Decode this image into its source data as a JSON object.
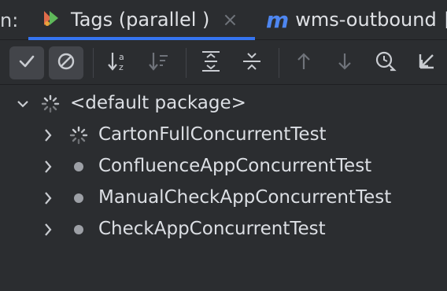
{
  "tabbar": {
    "prefix": "n:",
    "tabs": [
      {
        "label": "Tags (parallel )",
        "icon": "run-test-icon",
        "active": true,
        "close": "×"
      },
      {
        "label": "wms-outbound",
        "icon": "maven-module-icon",
        "active": false,
        "trail": "["
      }
    ]
  },
  "toolbar": {
    "buttons": [
      {
        "name": "show-passed-button",
        "icon": "check-icon",
        "toggled": true
      },
      {
        "name": "show-ignored-button",
        "icon": "ignored-icon",
        "toggled": true
      },
      {
        "name": "sort-alphabetically-button",
        "icon": "sort-alpha-icon",
        "toggled": false
      },
      {
        "name": "sort-by-duration-button",
        "icon": "sort-duration-icon",
        "toggled": false
      },
      {
        "name": "expand-all-button",
        "icon": "expand-all-icon",
        "toggled": false
      },
      {
        "name": "collapse-all-button",
        "icon": "collapse-all-icon",
        "toggled": false
      },
      {
        "name": "previous-failed-button",
        "icon": "arrow-up-icon",
        "toggled": false
      },
      {
        "name": "next-failed-button",
        "icon": "arrow-down-icon",
        "toggled": false
      },
      {
        "name": "test-history-button",
        "icon": "history-icon",
        "toggled": false
      },
      {
        "name": "import-tests-button",
        "icon": "import-icon",
        "toggled": false
      }
    ]
  },
  "tree": {
    "root": {
      "label": "<default package>",
      "expanded": true,
      "status": "running"
    },
    "items": [
      {
        "label": "CartonFullConcurrentTest",
        "status": "running"
      },
      {
        "label": "ConfluenceAppConcurrentTest",
        "status": "pending"
      },
      {
        "label": "ManualCheckAppConcurrentTest",
        "status": "pending"
      },
      {
        "label": "CheckAppConcurrentTest",
        "status": "pending"
      }
    ]
  },
  "colors": {
    "background": "#2b2d30",
    "accent": "#3574f0",
    "text": "#dcdfe4",
    "icon_muted": "#9da0a6"
  }
}
